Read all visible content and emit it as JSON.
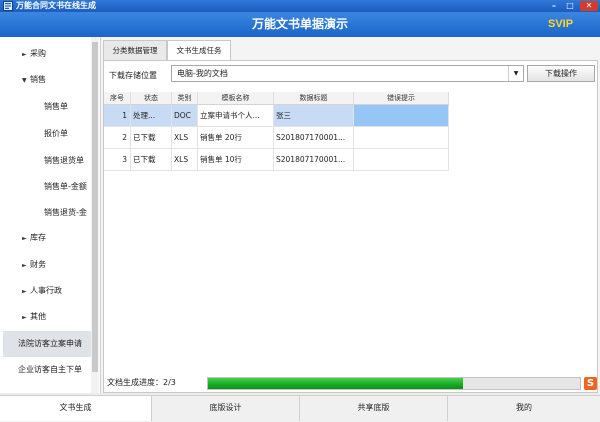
{
  "window": {
    "title": "万能合同文书在线生成",
    "icon": "app-icon"
  },
  "header": {
    "heading": "万能文书单据演示",
    "vip_badge": "SVIP"
  },
  "sidebar": {
    "items": [
      {
        "label": "采购",
        "type": "category",
        "icon": "expand-arrow-icon"
      },
      {
        "label": "销售",
        "type": "category-open",
        "icon": "collapse-arrow-icon"
      },
      {
        "label": "销售单",
        "type": "sub"
      },
      {
        "label": "报价单",
        "type": "sub"
      },
      {
        "label": "销售退货单",
        "type": "sub"
      },
      {
        "label": "销售单-金额",
        "type": "sub"
      },
      {
        "label": "销售退货-金",
        "type": "sub"
      },
      {
        "label": "库存",
        "type": "category",
        "icon": "expand-arrow-icon"
      },
      {
        "label": "财务",
        "type": "category",
        "icon": "expand-arrow-icon"
      },
      {
        "label": "人事行政",
        "type": "category",
        "icon": "expand-arrow-icon"
      },
      {
        "label": "其他",
        "type": "category",
        "icon": "expand-arrow-icon"
      },
      {
        "label": "法院访客立案申请",
        "type": "selected"
      },
      {
        "label": "企业访客自主下单",
        "type": "plain"
      }
    ]
  },
  "tabs": [
    {
      "label": "分类数据管理",
      "active": false
    },
    {
      "label": "文书生成任务",
      "active": true
    }
  ],
  "download": {
    "location_label": "下载存储位置",
    "location_value": "电脑-我的文档",
    "action_label": "下载操作"
  },
  "table": {
    "columns": [
      "序号",
      "状态",
      "类别",
      "模板名称",
      "数据标题",
      "错误提示"
    ],
    "rows": [
      {
        "no": "1",
        "status": "处理...",
        "type": "DOC",
        "template": "立案申请书个人...",
        "title": "张三",
        "error": ""
      },
      {
        "no": "2",
        "status": "已下载",
        "type": "XLS",
        "template": "销售单 20行",
        "title": "S201807170001...",
        "error": ""
      },
      {
        "no": "3",
        "status": "已下载",
        "type": "XLS",
        "template": "销售单 10行",
        "title": "S201807170001...",
        "error": ""
      }
    ]
  },
  "progress": {
    "label": "文档生成进度：2/3",
    "fraction": 0.685,
    "color": "#15a924"
  },
  "bottom_nav": [
    {
      "label": "文书生成",
      "active": true
    },
    {
      "label": "底版设计",
      "active": false
    },
    {
      "label": "共享底版",
      "active": false
    },
    {
      "label": "我的",
      "active": false
    }
  ]
}
